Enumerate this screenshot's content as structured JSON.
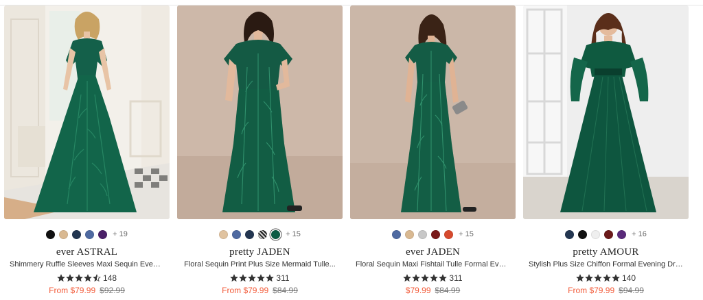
{
  "products": [
    {
      "image_alt": "Model in emerald green sequin maxi dress with flutter sleeves in a white room",
      "swatches": [
        "#111111",
        "#d9b992",
        "#233651",
        "#4f6aa1",
        "#4a2068"
      ],
      "selected_swatch": -1,
      "pattern_swatch": -1,
      "more": "+ 19",
      "brand": "ever ASTRAL",
      "title": "Shimmery Ruffle Sleeves Maxi Sequin Evening...",
      "stars": 4.5,
      "reviews": "148",
      "price_now": "From $79.99",
      "price_was": "$92.99"
    },
    {
      "image_alt": "Plus size model in emerald green floral sequin mermaid dress",
      "swatches": [
        "#e0c3a0",
        "#4f6aa1",
        "#233651",
        "#2b2b2b",
        "#0d5b45"
      ],
      "selected_swatch": 4,
      "pattern_swatch": 3,
      "more": "+ 15",
      "brand": "pretty JADEN",
      "title": "Floral Sequin Print Plus Size Mermaid Tulle...",
      "stars": 5,
      "reviews": "311",
      "price_now": "From $79.99",
      "price_was": "$84.99"
    },
    {
      "image_alt": "Model in emerald green sequin fishtail tulle dress holding a clutch",
      "swatches": [
        "#4f6aa1",
        "#d9b992",
        "#c8c8c8",
        "#7a1a1a",
        "#d64a2e"
      ],
      "selected_swatch": -1,
      "pattern_swatch": -1,
      "more": "+ 15",
      "brand": "ever JADEN",
      "title": "Floral Sequin Maxi Fishtail Tulle Formal Evening...",
      "stars": 5,
      "reviews": "311",
      "price_now": "$79.99",
      "price_was": "$84.99"
    },
    {
      "image_alt": "Plus size model in emerald green chiffon long sleeve evening dress",
      "swatches": [
        "#233651",
        "#111111",
        "#efefef",
        "#6b1a1a",
        "#5a2a7a"
      ],
      "selected_swatch": -1,
      "pattern_swatch": -1,
      "more": "+ 16",
      "brand": "pretty AMOUR",
      "title": "Stylish Plus Size Chiffon Formal Evening Dresses...",
      "stars": 5,
      "reviews": "140",
      "price_now": "From $79.99",
      "price_was": "$94.99"
    }
  ]
}
